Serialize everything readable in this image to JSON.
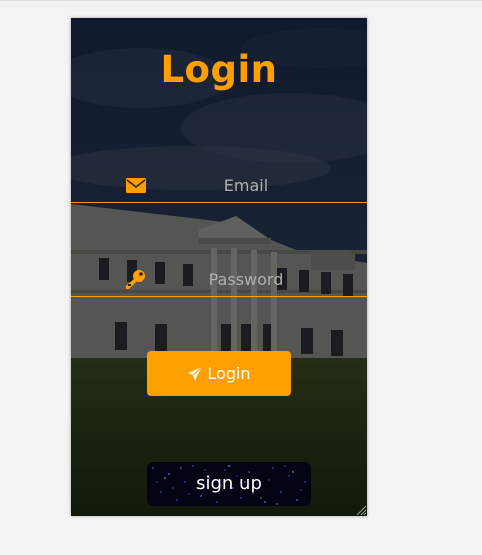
{
  "title": "Login",
  "email_field": {
    "placeholder": "Email",
    "value": ""
  },
  "password_field": {
    "placeholder": "Password",
    "value": ""
  },
  "login_button": {
    "label": "Login"
  },
  "signup_button": {
    "label": "sign up"
  },
  "icons": {
    "email": "envelope-icon",
    "password": "key-icon",
    "login": "paper-plane-icon"
  },
  "colors": {
    "accent": "#ffa000",
    "page_background": "#f3f3f3",
    "signup_background": "#020313",
    "text_light": "#ffffff"
  }
}
